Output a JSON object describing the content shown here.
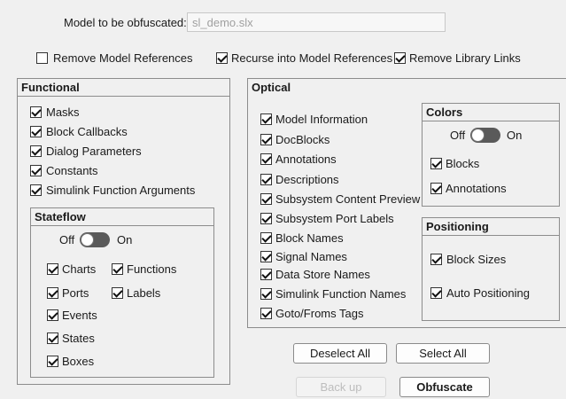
{
  "model_label": "Model to be obfuscated:",
  "model_value": "sl_demo.slx",
  "top_options": {
    "remove_model_refs": "Remove Model References",
    "recurse_model_refs": "Recurse into Model References",
    "remove_lib_links": "Remove Library Links"
  },
  "functional": {
    "title": "Functional",
    "items": [
      "Masks",
      "Block Callbacks",
      "Dialog Parameters",
      "Constants",
      "Simulink Function Arguments"
    ]
  },
  "stateflow": {
    "title": "Stateflow",
    "toggle_off": "Off",
    "toggle_on": "On",
    "items": [
      "Charts",
      "Functions",
      "Ports",
      "Labels",
      "Events",
      "States",
      "Boxes"
    ]
  },
  "optical": {
    "title": "Optical",
    "items": [
      "Model Information",
      "DocBlocks",
      "Annotations",
      "Descriptions",
      "Subsystem Content Preview",
      "Subsystem Port Labels",
      "Block Names",
      "Signal Names",
      "Data Store Names",
      "Simulink Function Names",
      "Goto/Froms Tags"
    ]
  },
  "colors": {
    "title": "Colors",
    "toggle_off": "Off",
    "toggle_on": "On",
    "items": [
      "Blocks",
      "Annotations"
    ]
  },
  "positioning": {
    "title": "Positioning",
    "items": [
      "Block Sizes",
      "Auto Positioning"
    ]
  },
  "buttons": {
    "deselect_all": "Deselect All",
    "select_all": "Select All",
    "back_up": "Back up",
    "obfuscate": "Obfuscate"
  }
}
